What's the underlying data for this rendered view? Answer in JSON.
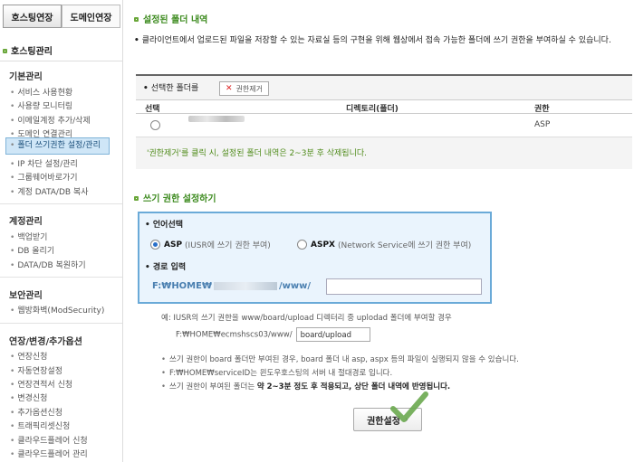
{
  "top_tabs": [
    "호스팅연장",
    "도메인연장"
  ],
  "sidebar": {
    "heading": "호스팅관리",
    "groups": [
      {
        "title": "기본관리",
        "items": [
          "서비스 사용현황",
          "사용량 모니터링",
          "이메일계정 추가/삭제",
          "도메인 연결관리",
          "폴더 쓰기권한 설정/관리",
          "IP 차단 설정/관리",
          "그룹웨어바로가기",
          "계정 DATA/DB 복사"
        ]
      },
      {
        "title": "계정관리",
        "items": [
          "백업받기",
          "DB 올리기",
          "DATA/DB 복원하기"
        ]
      },
      {
        "title": "보안관리",
        "items": [
          "웹방화벽(ModSecurity)"
        ]
      },
      {
        "title": "연장/변경/추가옵션",
        "items": [
          "연장신청",
          "자동연장설정",
          "연장견적서 신청",
          "변경신청",
          "추가옵션신청",
          "트래픽리셋신청",
          "클라우드플레어 신청",
          "클라우드플레어 관리"
        ]
      }
    ],
    "selected_item": "폴더 쓰기권한 설정/관리"
  },
  "section1": {
    "title": "설정된 폴더 내역",
    "description": "클라이언트에서 업로드된 파일을 저장할 수 있는 자료실 등의 구현을 위해 웹상에서 접속 가능한 폴더에 쓰기 권한을 부여하실 수 있습니다.",
    "toolbar_label": "선택한 폴더를",
    "remove_button": "권한제거",
    "columns": [
      "선택",
      "디렉토리(폴더)",
      "권한"
    ],
    "rows": [
      {
        "permission": "ASP"
      }
    ],
    "note": "'권한제거'를 클릭 시, 설정된 폴더 내역은 2~3분 후 삭제됩니다."
  },
  "section2": {
    "title": "쓰기 권한 설정하기",
    "language_label": "언어선택",
    "option_asp": "ASP",
    "option_asp_hint": "(IUSR에 쓰기 권한 부여)",
    "option_aspx": "ASPX",
    "option_aspx_hint": "(Network Service에 쓰기 권한 부여)",
    "path_label": "경로 입력",
    "path_prefix": "F:₩HOME₩",
    "path_suffix": "/www/",
    "path_value": "",
    "example_line1": "예: IUSR의 쓰기 권한을 www/board/upload 디렉터리 중 uplodad 폴더에 부여할 경우",
    "example_line2": "F:₩HOME₩ecmshscs03/www/",
    "example_value": "board/upload",
    "notes": [
      "쓰기 권한이 board 폴더만 부여된 경우, board 폴더 내 asp, aspx 등의 파일이 실행되지 않을 수 있습니다.",
      "F:₩HOME₩serviceID는 윈도우호스팅의 서버 내 절대경로 입니다."
    ],
    "note3_start": "쓰기 권한이 부여된 폴더는 ",
    "note3_bold": "약 2~3분 정도 후 적용되고, 상단 폴더 내역에 반영됩니다.",
    "apply_button": "권한설정"
  },
  "colors": {
    "accent_green": "#3d8b1f",
    "box_border": "#6aaad8",
    "box_bg": "#eaf4fd",
    "check_green": "#6aa84f"
  }
}
